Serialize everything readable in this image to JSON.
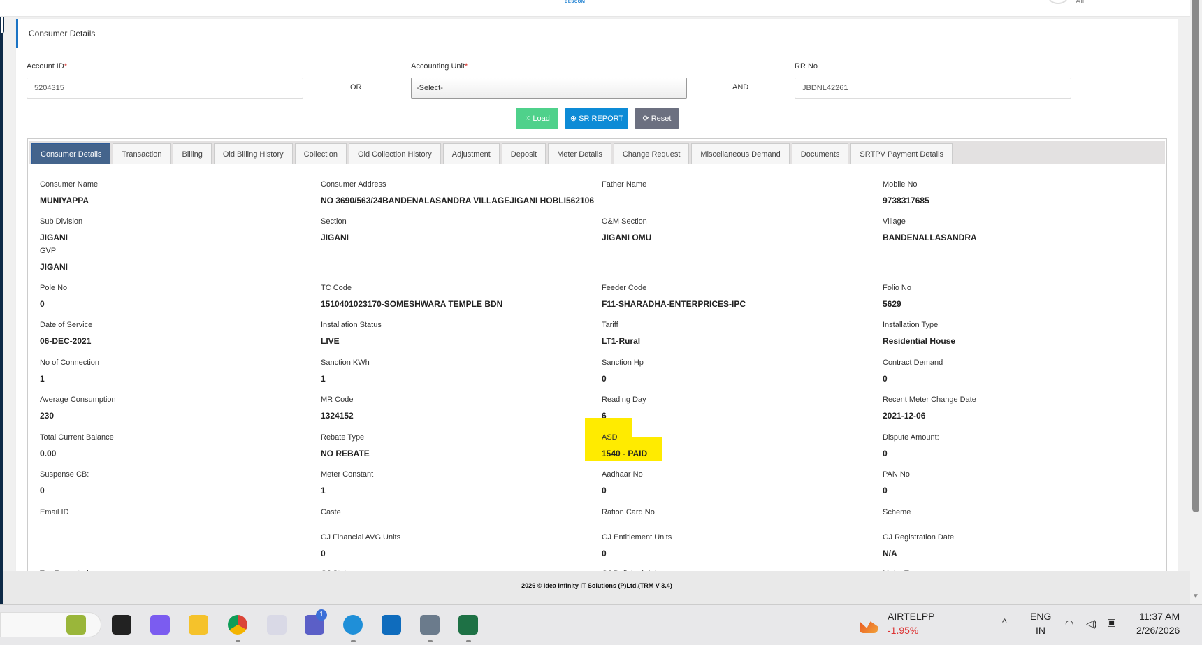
{
  "header": {
    "logo_text": "BESCOM",
    "user_label": "All"
  },
  "page": {
    "title": "Consumer Details"
  },
  "form": {
    "account_id_label": "Account ID",
    "account_id_value": "5204315",
    "or_label": "OR",
    "accounting_unit_label": "Accounting Unit",
    "accounting_unit_value": "-Select-",
    "and_label": "AND",
    "rr_no_label": "RR No",
    "rr_no_value": "JBDNL42261",
    "required_mark": "*",
    "buttons": {
      "load": "Load",
      "sr_report": "SR REPORT",
      "reset": "Reset"
    }
  },
  "colors": {
    "load": "#4fd18b",
    "sr_report": "#0d8bd6",
    "reset": "#6c7080",
    "active_tab": "#44648c",
    "highlight": "#ffeb00"
  },
  "tabs": [
    "Consumer Details",
    "Transaction",
    "Billing",
    "Old Billing History",
    "Collection",
    "Old Collection History",
    "Adjustment",
    "Deposit",
    "Meter Details",
    "Change Request",
    "Miscellaneous Demand",
    "Documents",
    "SRTPV Payment Details"
  ],
  "active_tab": 0,
  "details": {
    "rows": [
      [
        {
          "label": "Consumer Name",
          "value": "MUNIYAPPA"
        },
        {
          "label": "Consumer Address",
          "value": "NO 3690/563/24BANDENALASANDRA VILLAGEJIGANI HOBLI562106"
        },
        {
          "label": "Father Name",
          "value": ""
        },
        {
          "label": "Mobile No",
          "value": "9738317685"
        }
      ],
      [
        {
          "label": "Sub Division",
          "value": "JIGANI",
          "extra": {
            "label": "GVP",
            "value": "JIGANI"
          }
        },
        {
          "label": "Section",
          "value": "JIGANI"
        },
        {
          "label": "O&M Section",
          "value": "JIGANI OMU"
        },
        {
          "label": "Village",
          "value": "BANDENALLASANDRA"
        }
      ],
      [
        {
          "label": "Pole No",
          "value": "0"
        },
        {
          "label": "TC Code",
          "value": "1510401023170-SOMESHWARA TEMPLE BDN"
        },
        {
          "label": "Feeder Code",
          "value": "F11-SHARADHA-ENTERPRICES-IPC"
        },
        {
          "label": "Folio No",
          "value": "5629"
        }
      ],
      [
        {
          "label": "Date of Service",
          "value": "06-DEC-2021"
        },
        {
          "label": "Installation Status",
          "value": "LIVE"
        },
        {
          "label": "Tariff",
          "value": "LT1-Rural"
        },
        {
          "label": "Installation Type",
          "value": "Residential House"
        }
      ],
      [
        {
          "label": "No of Connection",
          "value": "1"
        },
        {
          "label": "Sanction KWh",
          "value": "1"
        },
        {
          "label": "Sanction Hp",
          "value": "0"
        },
        {
          "label": "Contract Demand",
          "value": "0"
        }
      ],
      [
        {
          "label": "Average Consumption",
          "value": "230"
        },
        {
          "label": "MR Code",
          "value": "1324152"
        },
        {
          "label": "Reading Day",
          "value": "6"
        },
        {
          "label": "Recent Meter Change Date",
          "value": "2021-12-06"
        }
      ],
      [
        {
          "label": "Total Current Balance",
          "value": "0.00"
        },
        {
          "label": "Rebate Type",
          "value": "NO REBATE"
        },
        {
          "label": "ASD",
          "value": "1540 - PAID",
          "highlight": true
        },
        {
          "label": "Dispute Amount:",
          "value": "0"
        }
      ],
      [
        {
          "label": "Suspense CB:",
          "value": "0"
        },
        {
          "label": "Meter Constant",
          "value": "1"
        },
        {
          "label": "Aadhaar No",
          "value": "0"
        },
        {
          "label": "PAN No",
          "value": "0"
        }
      ],
      [
        {
          "label": "Email ID",
          "value": ""
        },
        {
          "label": "Caste",
          "value": ""
        },
        {
          "label": "Ration Card No",
          "value": ""
        },
        {
          "label": "Scheme",
          "value": ""
        }
      ],
      [
        null,
        {
          "label": "GJ Financial AVG Units",
          "value": "0"
        },
        {
          "label": "GJ Entitlement Units",
          "value": "0"
        },
        {
          "label": "GJ Registration Date",
          "value": "N/A"
        }
      ],
      [
        {
          "label": "Tax Exempted",
          "value": ""
        },
        {
          "label": "GJ Status",
          "value": ""
        },
        {
          "label": "GJ Delinked date",
          "value": ""
        },
        {
          "label": "Meter Type",
          "value": ""
        }
      ]
    ]
  },
  "footer": {
    "text": "2026 © Idea Infinity IT Solutions (P)Ltd.(TRM V 3.4)"
  },
  "taskbar": {
    "apps": [
      "pistachio-widget",
      "task-view",
      "copilot",
      "file-explorer",
      "chrome",
      "snipping-tool",
      "teams",
      "edge",
      "outlook",
      "calculator",
      "excel"
    ],
    "teams_badge": "1",
    "stock_name": "AIRTELPP",
    "stock_change": "-1.95%",
    "lang_top": "ENG",
    "lang_bottom": "IN",
    "time": "11:37 AM",
    "date": "2/26/2026"
  }
}
